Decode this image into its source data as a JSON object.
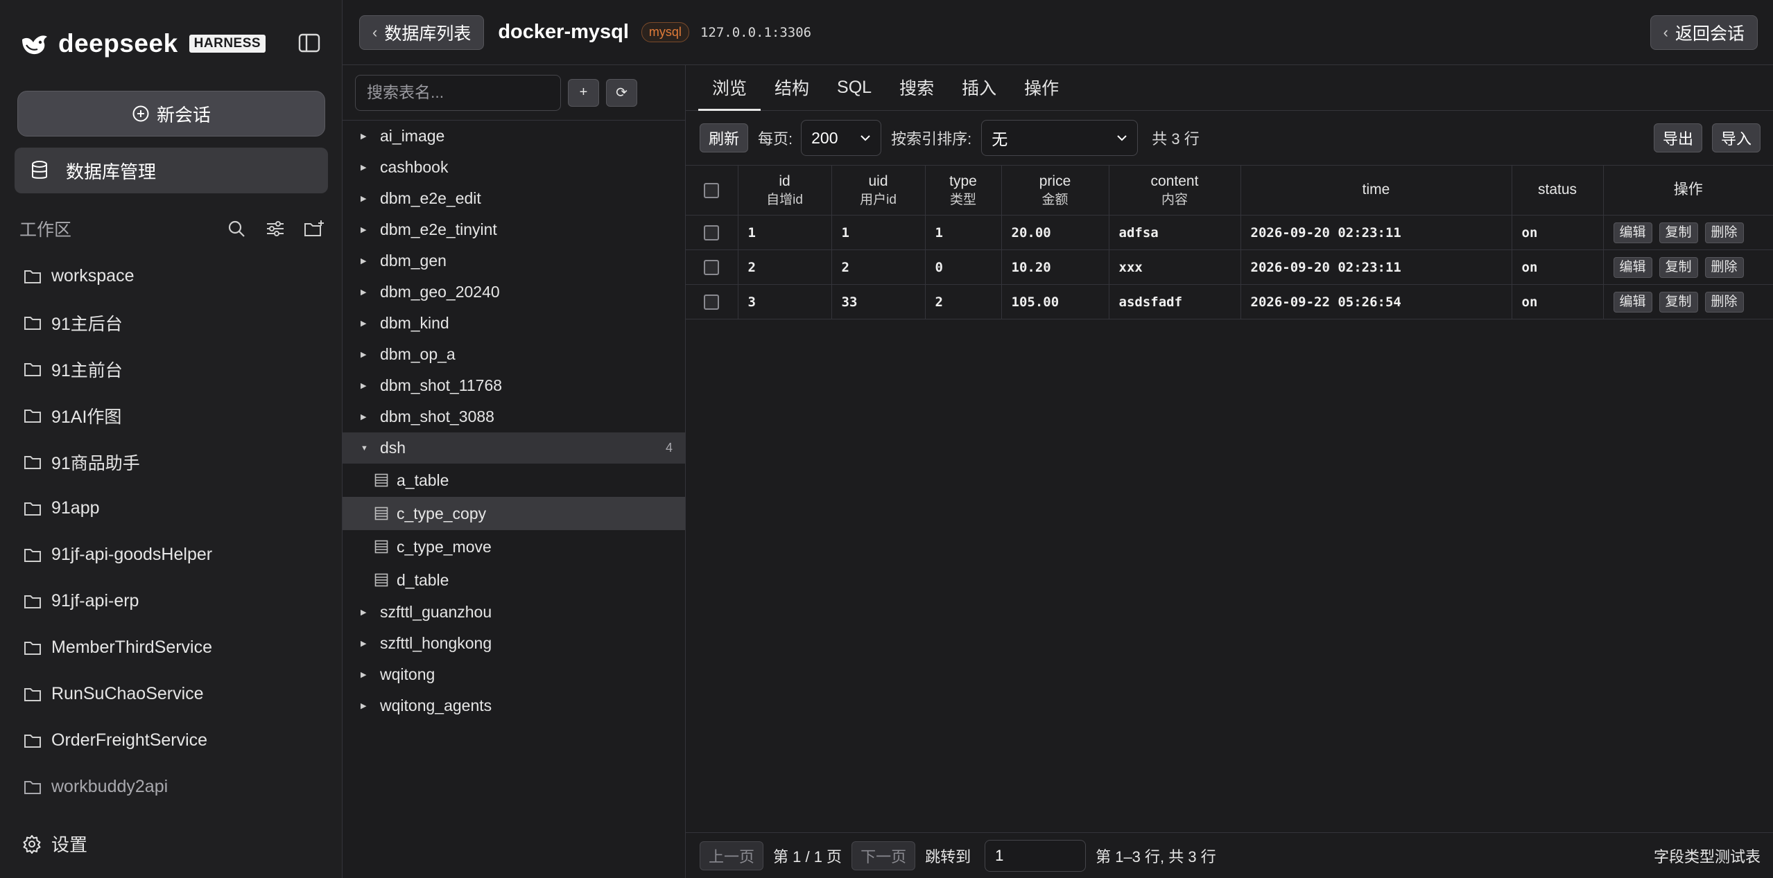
{
  "brand": {
    "name": "deepseek",
    "badge": "HARNESS"
  },
  "sidebar": {
    "new_chat_label": "新会话",
    "db_manage_label": "数据库管理",
    "workspace_title": "工作区",
    "folders": [
      "workspace",
      "91主后台",
      "91主前台",
      "91AI作图",
      "91商品助手",
      "91app",
      "91jf-api-goodsHelper",
      "91jf-api-erp",
      "MemberThirdService",
      "RunSuChaoService",
      "OrderFreightService",
      "workbuddy2api"
    ],
    "settings_label": "设置"
  },
  "topbar": {
    "back_label": "数据库列表",
    "conn_name": "docker-mysql",
    "conn_type": "mysql",
    "conn_addr": "127.0.0.1:3306",
    "return_label": "返回会话"
  },
  "tree": {
    "search_placeholder": "搜索表名...",
    "add_label": "+",
    "refresh_label": "⟳",
    "dbs_before": [
      "ai_image",
      "cashbook",
      "dbm_e2e_edit",
      "dbm_e2e_tinyint",
      "dbm_gen",
      "dbm_geo_20240",
      "dbm_kind",
      "dbm_op_a",
      "dbm_shot_11768",
      "dbm_shot_3088"
    ],
    "active_db": {
      "name": "dsh",
      "count": "4"
    },
    "tables": [
      "a_table",
      "c_type_copy",
      "c_type_move",
      "d_table"
    ],
    "dbs_after": [
      "szfttl_guanzhou",
      "szfttl_hongkong",
      "wqitong",
      "wqitong_agents"
    ]
  },
  "tabs": [
    "浏览",
    "结构",
    "SQL",
    "搜索",
    "插入",
    "操作"
  ],
  "toolbar": {
    "refresh_label": "刷新",
    "per_page_label": "每页:",
    "per_page_value": "200",
    "sort_label": "按索引排序:",
    "sort_value": "无",
    "total_rows": "共 3 行",
    "export_label": "导出",
    "import_label": "导入"
  },
  "grid": {
    "columns": [
      {
        "name": "id",
        "sub": "自增id"
      },
      {
        "name": "uid",
        "sub": "用户id"
      },
      {
        "name": "type",
        "sub": "类型"
      },
      {
        "name": "price",
        "sub": "金额"
      },
      {
        "name": "content",
        "sub": "内容"
      },
      {
        "name": "time",
        "sub": ""
      },
      {
        "name": "status",
        "sub": ""
      },
      {
        "name": "操作",
        "sub": ""
      }
    ],
    "rows": [
      {
        "id": "1",
        "uid": "1",
        "type": "1",
        "price": "20.00",
        "content": "adfsa",
        "time": "2026-09-20 02:23:11",
        "status": "on"
      },
      {
        "id": "2",
        "uid": "2",
        "type": "0",
        "price": "10.20",
        "content": "xxx",
        "time": "2026-09-20 02:23:11",
        "status": "on"
      },
      {
        "id": "3",
        "uid": "33",
        "type": "2",
        "price": "105.00",
        "content": "asdsfadf",
        "time": "2026-09-22 05:26:54",
        "status": "on"
      }
    ],
    "row_actions": {
      "edit": "编辑",
      "copy": "复制",
      "delete": "删除"
    }
  },
  "pager": {
    "prev_label": "上一页",
    "page_info": "第 1 / 1 页",
    "next_label": "下一页",
    "jump_label": "跳转到",
    "jump_value": "1",
    "range_info": "第 1–3 行, 共 3 行",
    "table_comment": "字段类型测试表"
  },
  "colors": {
    "bg": "#1c1c1e",
    "sidebar": "#1f1f21",
    "accent": "#e07b39",
    "border": "#34343a"
  }
}
